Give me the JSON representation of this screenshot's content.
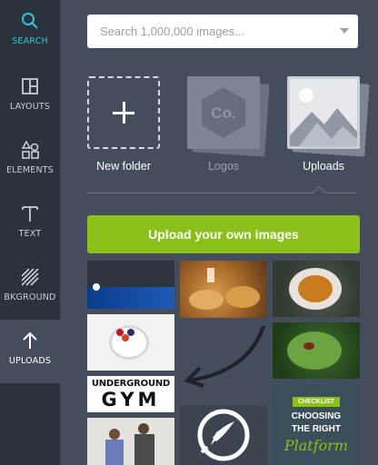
{
  "sidebar": {
    "items": [
      {
        "label": "SEARCH",
        "icon": "magnifier-icon",
        "active": false
      },
      {
        "label": "LAYOUTS",
        "icon": "layouts-icon",
        "active": false
      },
      {
        "label": "ELEMENTS",
        "icon": "shapes-icon",
        "active": false
      },
      {
        "label": "TEXT",
        "icon": "text-t-icon",
        "active": false
      },
      {
        "label": "BKGROUND",
        "icon": "hatch-pattern-icon",
        "active": false
      },
      {
        "label": "UPLOADS",
        "icon": "upload-arrow-icon",
        "active": true
      }
    ]
  },
  "search": {
    "placeholder": "Search 1,000,000 images..."
  },
  "folders": {
    "new_folder": "New folder",
    "logos": "Logos",
    "logos_badge": "Co.",
    "uploads": "Uploads"
  },
  "upload_button": "Upload your own images",
  "gallery": {
    "gym_line1": "UNDERGROUND",
    "gym_line2": "GYM",
    "card_tag": "CHECKLIST",
    "card_line1": "CHOOSING",
    "card_line2": "THE RIGHT",
    "card_line3": "Platform"
  },
  "colors": {
    "rail": "#2b323c",
    "panel": "#444d5b",
    "accent": "#2fc6d4",
    "upload_green": "#8ac01a"
  }
}
